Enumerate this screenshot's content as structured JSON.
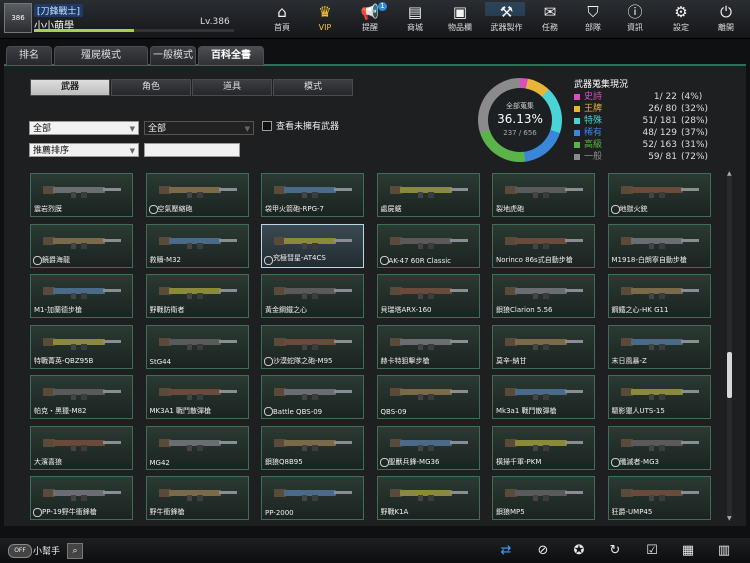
{
  "profile": {
    "rank": "[刀鋒戰士]",
    "name": "小小萌學",
    "level": "Lv.386",
    "avatar_text": "386",
    "xp_fraction": 0.5
  },
  "nav": [
    {
      "label": "首頁",
      "icon": "home-icon",
      "glyph": "⌂"
    },
    {
      "label": "VIP",
      "icon": "crown-icon",
      "glyph": "♛"
    },
    {
      "label": "提醒",
      "icon": "megaphone-icon",
      "glyph": "📢",
      "badge": "1"
    },
    {
      "label": "商城",
      "icon": "store-icon",
      "glyph": "▤"
    },
    {
      "label": "物品欄",
      "icon": "bag-icon",
      "glyph": "▣"
    },
    {
      "label": "武器製作",
      "icon": "weapon-craft-icon",
      "glyph": "⚒"
    },
    {
      "label": "任務",
      "icon": "mission-icon",
      "glyph": "✉"
    },
    {
      "label": "部隊",
      "icon": "squad-icon",
      "glyph": "⛉"
    },
    {
      "label": "資訊",
      "icon": "info-icon",
      "glyph": "ⓘ"
    },
    {
      "label": "設定",
      "icon": "gear-icon",
      "glyph": "⚙"
    },
    {
      "label": "離開",
      "icon": "power-icon",
      "glyph": "⏻"
    }
  ],
  "tabs": [
    "排名",
    "殭屍模式",
    "一般模式",
    "百科全書"
  ],
  "subtabs": [
    "武器",
    "角色",
    "道具",
    "模式"
  ],
  "filters": {
    "filter1": "全部",
    "filter2": "全部",
    "sort": "推薦排序",
    "search": "",
    "unowned_label": "查看未擁有武器"
  },
  "collection": {
    "title": "武器蒐集現況",
    "ring_label": "全部蒐集",
    "percent": "36.13%",
    "count": "237 / 656",
    "rows": [
      {
        "name": "史詩",
        "count": "1/ 22",
        "pct": "(4%)",
        "color": "#d84fc2"
      },
      {
        "name": "王牌",
        "count": "26/ 80",
        "pct": "(32%)",
        "color": "#e7b53a"
      },
      {
        "name": "特殊",
        "count": "51/ 181",
        "pct": "(28%)",
        "color": "#4bd4d6"
      },
      {
        "name": "稀有",
        "count": "48/ 129",
        "pct": "(37%)",
        "color": "#3a86d8"
      },
      {
        "name": "高級",
        "count": "52/ 163",
        "pct": "(31%)",
        "color": "#5cb349"
      },
      {
        "name": "一般",
        "count": "59/ 81",
        "pct": "(72%)",
        "color": "#8b8b8b"
      }
    ]
  },
  "weapons": [
    [
      "震岩烈膜",
      "空氣壓縮砲",
      "袋甲火箭砲-RPG-7",
      "處屍鋸",
      "裂地虎砲",
      "地獄火銃"
    ],
    [
      "鏡爵海龍",
      "救贖-M32",
      "究極彗星-AT4CS",
      "AK-47 60R Classic",
      "Norinco 86s式自動步槍",
      "M1918-白朗寧自動步槍"
    ],
    [
      "M1-加蘭德步槍",
      "野戰防衛者",
      "黃金鋼鐵之心",
      "貝瑞塔ARX-160",
      "鋇狼Clarion 5.56",
      "鋼鐵之心-HK G11"
    ],
    [
      "特戰菁英-QBZ95B",
      "StG44",
      "沙漠蛇隊之砲-M95",
      "赫卡特狙擊步槍",
      "莫辛-納甘",
      "末日風暴-Z"
    ],
    [
      "帕克・黑獵-M82",
      "MK3A1 戰鬥散彈槍",
      "Battle QBS-09",
      "QBS-09",
      "Mk3a1 戰鬥散彈槍",
      "驅影獵人UTS-15"
    ],
    [
      "大濱喜狼",
      "MG42",
      "鋇狼Q8B95",
      "聖獸兵鋒-MG36",
      "橫掃千軍-PKM",
      "殲滅者-MG3"
    ],
    [
      "PP-19野牛衝鋒槍",
      "野牛衝鋒槍",
      "PP-2000",
      "野戰K1A",
      "鋇狼MP5",
      "狂爵-UMP45"
    ]
  ],
  "owned_markers": [
    [
      0,
      1
    ],
    [
      0,
      5
    ],
    [
      1,
      0
    ],
    [
      1,
      2
    ],
    [
      1,
      3
    ],
    [
      3,
      2
    ],
    [
      4,
      2
    ],
    [
      5,
      3
    ],
    [
      5,
      5
    ],
    [
      6,
      0
    ]
  ],
  "selected_card": [
    1,
    2
  ],
  "help": {
    "label": "小幫手",
    "toggle": "OFF"
  },
  "bottom_icons": [
    {
      "icon": "sync-icon",
      "glyph": "⇄"
    },
    {
      "icon": "compass-icon",
      "glyph": "⊘"
    },
    {
      "icon": "runner-icon",
      "glyph": "✪"
    },
    {
      "icon": "refresh-icon",
      "glyph": "↻"
    },
    {
      "icon": "checklist-icon",
      "glyph": "☑"
    },
    {
      "icon": "calendar-icon",
      "glyph": "▦"
    },
    {
      "icon": "film-icon",
      "glyph": "▥"
    }
  ]
}
